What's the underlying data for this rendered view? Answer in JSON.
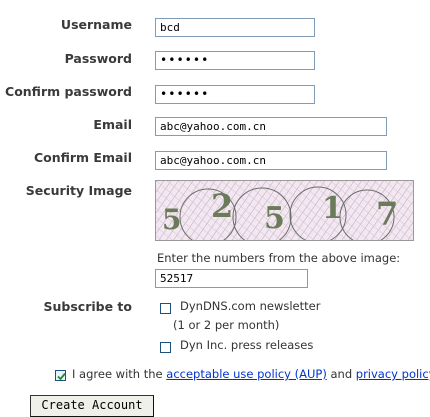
{
  "form": {
    "username": {
      "label": "Username",
      "value": "bcd"
    },
    "password": {
      "label": "Password",
      "value": "••••••"
    },
    "confirm_password": {
      "label": "Confirm password",
      "value": "••••••"
    },
    "email": {
      "label": "Email",
      "value": "abc@yahoo.com.cn"
    },
    "confirm_email": {
      "label": "Confirm Email",
      "value": "abc@yahoo.com.cn"
    },
    "security": {
      "label": "Security Image",
      "instruction": "Enter the numbers from the above image:",
      "value": "52517"
    },
    "subscribe": {
      "label": "Subscribe to",
      "newsletter": "DynDNS.com newsletter",
      "newsletter_note": "(1 or 2 per month)",
      "press": "Dyn Inc. press releases"
    },
    "agree": {
      "prefix": "I agree with the",
      "aup_link": "acceptable use policy (AUP)",
      "and": "and",
      "privacy_link": "privacy policy"
    },
    "submit_label": "Create Account"
  },
  "colors": {
    "link": "#0033cc",
    "input_border": "#7f9db9"
  }
}
